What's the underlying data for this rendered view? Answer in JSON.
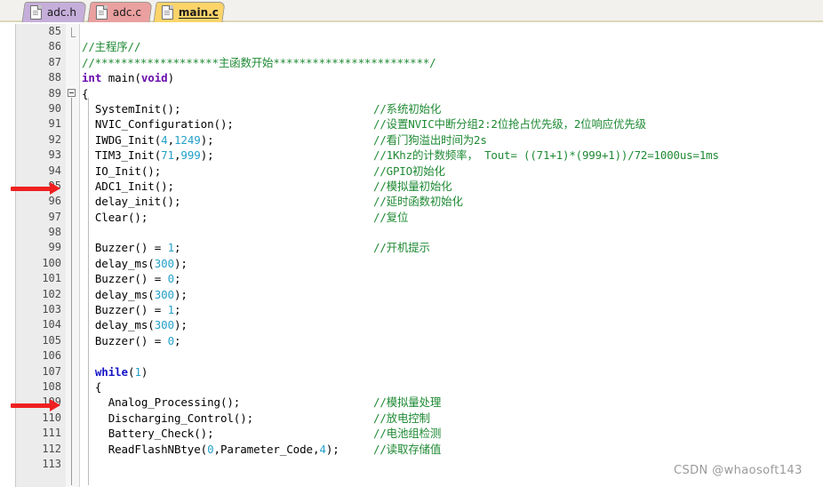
{
  "window": {
    "title": "main.c",
    "watermark": "CSDN @whaosoft143"
  },
  "tabs": [
    {
      "label": "adc.h",
      "color": "#c6aedb",
      "active": false,
      "icon": "file-icon"
    },
    {
      "label": "adc.c",
      "color": "#eba0a0",
      "active": false,
      "icon": "file-icon"
    },
    {
      "label": "main.c",
      "color": "#fcd469",
      "active": true,
      "icon": "file-icon"
    }
  ],
  "editor": {
    "first_line": 85,
    "last_line": 113,
    "markers": [
      {
        "line": 95,
        "type": "arrow",
        "color": "#ef2020"
      },
      {
        "line": 109,
        "type": "arrow",
        "color": "#ef2020"
      }
    ],
    "colors": {
      "comment": "#1f8a34",
      "keyword": "#1414c8",
      "keyword_type": "#6a0dad",
      "number": "#23a0c8",
      "text": "#000000",
      "gutter_bg": "#ececec",
      "background": "#ffffff"
    },
    "lines": [
      {
        "n": 85,
        "code": "",
        "comment": ""
      },
      {
        "n": 86,
        "code": "",
        "comment_inline": "//主程序//"
      },
      {
        "n": 87,
        "code": "",
        "comment_inline": "//*******************主函数开始************************/"
      },
      {
        "n": 88,
        "code_html": "int main(void)",
        "comment": ""
      },
      {
        "n": 89,
        "code": "{",
        "comment": ""
      },
      {
        "n": 90,
        "code": "  SystemInit();",
        "comment": "//系统初始化"
      },
      {
        "n": 91,
        "code": "  NVIC_Configuration();",
        "comment": "//设置NVIC中断分组2:2位抢占优先级，2位响应优先级"
      },
      {
        "n": 92,
        "code": "  IWDG_Init(4,1249);",
        "comment": "//看门狗溢出时间为2s"
      },
      {
        "n": 93,
        "code": "  TIM3_Init(71,999);",
        "comment": "//1Khz的计数频率，  Tout= ((71+1)*(999+1))/72=1000us=1ms"
      },
      {
        "n": 94,
        "code": "  IO_Init();",
        "comment": "//GPIO初始化"
      },
      {
        "n": 95,
        "code": "  ADC1_Init();",
        "comment": "//模拟量初始化"
      },
      {
        "n": 96,
        "code": "  delay_init();",
        "comment": "//延时函数初始化"
      },
      {
        "n": 97,
        "code": "  Clear();",
        "comment": "//复位"
      },
      {
        "n": 98,
        "code": "",
        "comment": ""
      },
      {
        "n": 99,
        "code": "  Buzzer() = 1;",
        "comment": "//开机提示"
      },
      {
        "n": 100,
        "code": "  delay_ms(300);",
        "comment": ""
      },
      {
        "n": 101,
        "code": "  Buzzer() = 0;",
        "comment": ""
      },
      {
        "n": 102,
        "code": "  delay_ms(300);",
        "comment": ""
      },
      {
        "n": 103,
        "code": "  Buzzer() = 1;",
        "comment": ""
      },
      {
        "n": 104,
        "code": "  delay_ms(300);",
        "comment": ""
      },
      {
        "n": 105,
        "code": "  Buzzer() = 0;",
        "comment": ""
      },
      {
        "n": 106,
        "code": "",
        "comment": ""
      },
      {
        "n": 107,
        "code": "  while(1)",
        "comment": ""
      },
      {
        "n": 108,
        "code": "  {",
        "comment": ""
      },
      {
        "n": 109,
        "code": "    Analog_Processing();",
        "comment": "//模拟量处理"
      },
      {
        "n": 110,
        "code": "    Discharging_Control();",
        "comment": "//放电控制"
      },
      {
        "n": 111,
        "code": "    Battery_Check();",
        "comment": "//电池组检测"
      },
      {
        "n": 112,
        "code": "    ReadFlashNBtye(0,Parameter_Code,4);",
        "comment": "//读取存储值"
      },
      {
        "n": 113,
        "code": "",
        "comment": ""
      }
    ]
  }
}
